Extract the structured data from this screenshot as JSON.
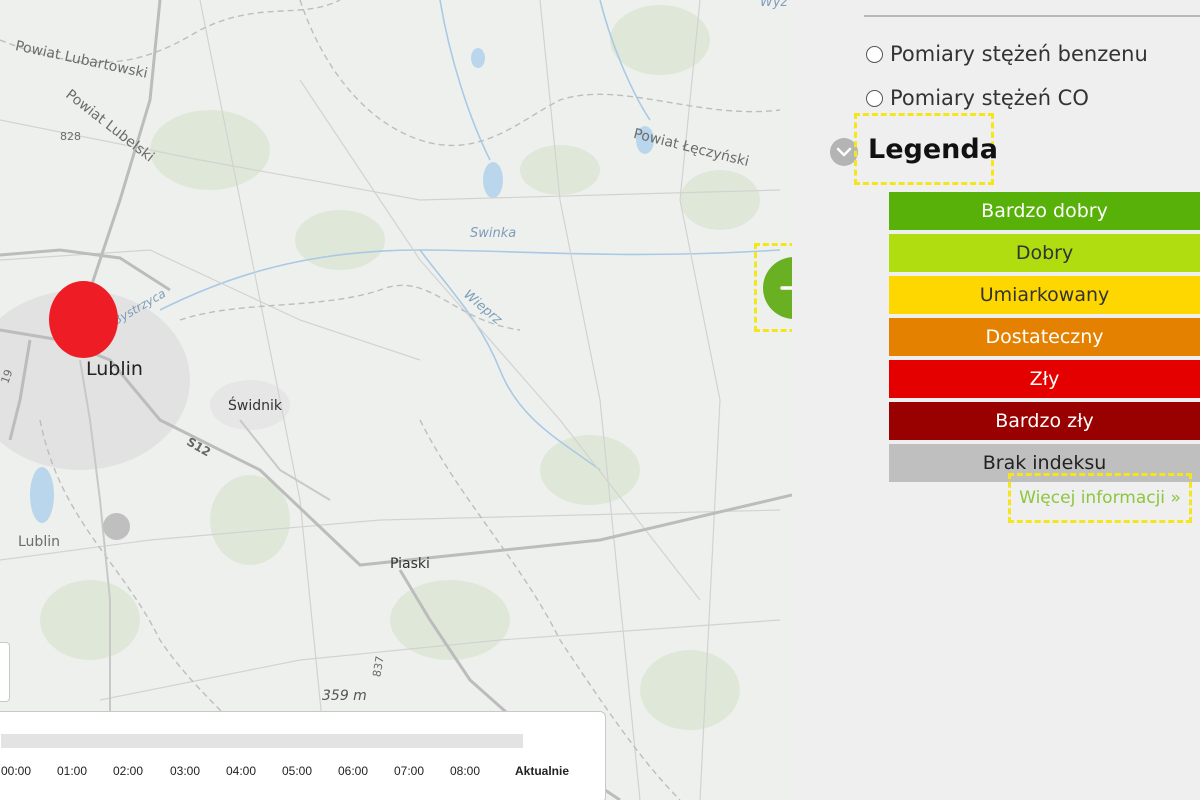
{
  "map": {
    "labels": {
      "powiat_lubartowski": "Powiat Lubartowski",
      "powiat_lubelski": "Powiat Lubelski",
      "powiat_leczynski": "Powiat Łęczyński",
      "road_828": "828",
      "road_837": "837",
      "road_s12": "S12",
      "road_19": "19",
      "swinka": "Swinka",
      "wieprz": "Wieprz",
      "bystrzyca": "Bystrzyca",
      "lublin": "Lublin",
      "lublin_gmina": "Lublin",
      "swidnik": "Świdnik",
      "piaski": "Piaski",
      "elevation": "359 m",
      "wyz": "Wyż"
    },
    "markers": [
      {
        "name": "station-red",
        "color": "#ee1c25"
      },
      {
        "name": "station-gray",
        "color": "#bfbfbf"
      }
    ],
    "arrow_icon": "arrow-right-icon"
  },
  "timeline": {
    "ticks": [
      "00:00",
      "01:00",
      "02:00",
      "03:00",
      "04:00",
      "05:00",
      "06:00",
      "07:00",
      "08:00"
    ],
    "current": "Aktualnie"
  },
  "panel": {
    "options": [
      {
        "label": "Pomiary stężeń benzenu"
      },
      {
        "label": "Pomiary stężeń CO"
      }
    ],
    "legend_title": "Legenda",
    "legend_items": [
      {
        "label": "Bardzo dobry",
        "bg": "#57b108",
        "fg": "#ffffff"
      },
      {
        "label": "Dobry",
        "bg": "#b0dd10",
        "fg": "#333333"
      },
      {
        "label": "Umiarkowany",
        "bg": "#fed700",
        "fg": "#333333"
      },
      {
        "label": "Dostateczny",
        "bg": "#e58100",
        "fg": "#ffffff"
      },
      {
        "label": "Zły",
        "bg": "#e50000",
        "fg": "#ffffff"
      },
      {
        "label": "Bardzo zły",
        "bg": "#990000",
        "fg": "#ffffff"
      },
      {
        "label": "Brak indeksu",
        "bg": "#bfbfbf",
        "fg": "#222222"
      }
    ],
    "more_link": "Więcej informacji »"
  }
}
